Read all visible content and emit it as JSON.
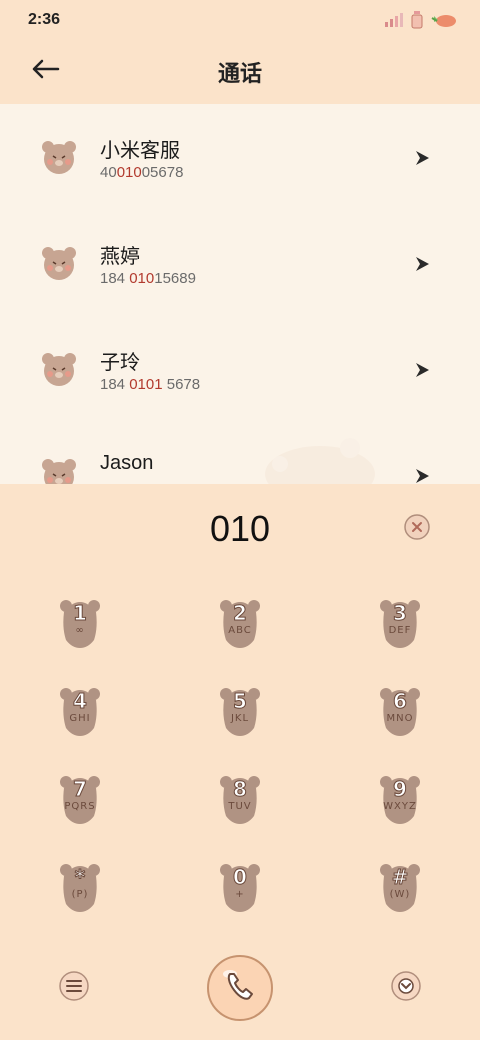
{
  "status": {
    "time": "2:36"
  },
  "header": {
    "title": "通话"
  },
  "contacts": [
    {
      "name": "小米客服",
      "num_pre": "40",
      "num_hl": "010",
      "num_post": "05678"
    },
    {
      "name": "燕婷",
      "num_pre": "184 ",
      "num_hl": "010",
      "num_post": "15689"
    },
    {
      "name": "子玲",
      "num_pre": "184 ",
      "num_hl": "0101",
      "num_post": " 5678"
    },
    {
      "name": "Jason",
      "num_pre": "",
      "num_hl": "",
      "num_post": ""
    }
  ],
  "dialer": {
    "input": "010",
    "keys": [
      {
        "digit": "1",
        "letters": "∞"
      },
      {
        "digit": "2",
        "letters": "ABC"
      },
      {
        "digit": "3",
        "letters": "DEF"
      },
      {
        "digit": "4",
        "letters": "GHI"
      },
      {
        "digit": "5",
        "letters": "JKL"
      },
      {
        "digit": "6",
        "letters": "MNO"
      },
      {
        "digit": "7",
        "letters": "PQRS"
      },
      {
        "digit": "8",
        "letters": "TUV"
      },
      {
        "digit": "9",
        "letters": "WXYZ"
      },
      {
        "digit": "*",
        "letters": "(P)"
      },
      {
        "digit": "0",
        "letters": "+"
      },
      {
        "digit": "#",
        "letters": "(W)"
      }
    ]
  },
  "colors": {
    "header_bg": "#fbe3ca",
    "list_bg": "#fbf3e8",
    "highlight": "#b23a2e",
    "key_brown": "#b09383"
  },
  "icons": {
    "back": "arrow-left-icon",
    "arrow": "chevron-right-icon",
    "clear": "clear-x-icon",
    "menu": "menu-icon",
    "call": "phone-icon",
    "collapse": "chevron-down-icon"
  }
}
